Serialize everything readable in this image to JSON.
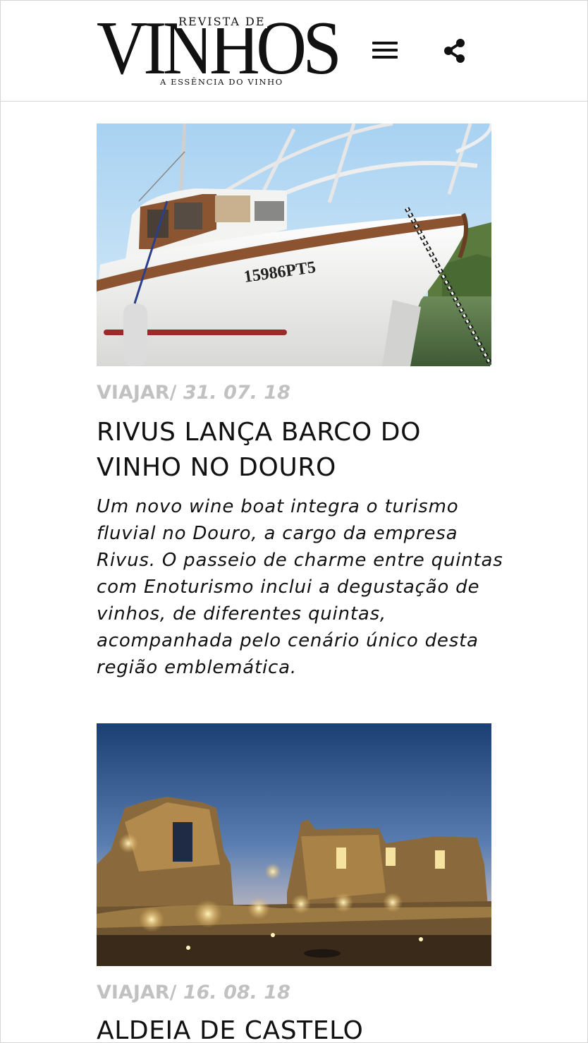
{
  "header": {
    "logo_top": "REVISTA DE",
    "logo_main": "VINHOS",
    "logo_tagline": "A ESSÊNCIA DO VINHO",
    "menu_icon": "hamburger-menu-icon",
    "share_icon": "share-icon"
  },
  "articles": [
    {
      "category": "VIAJAR/",
      "date": " 31. 07. 18",
      "title": "RIVUS LANÇA BARCO DO VINHO NO DOURO",
      "excerpt": "Um novo wine boat integra o turismo fluvial no Douro, a cargo da empresa Rivus. O passeio de charme entre quintas com Enoturismo inclui a degustação de vinhos, de diferentes quintas, acompanhada pelo cenário único desta região emblemática.",
      "image_text": "15986PT5"
    },
    {
      "category": "VIAJAR/",
      "date": " 16. 08. 18",
      "title": "ALDEIA DE CASTELO"
    }
  ],
  "colors": {
    "meta_gray": "#c1c1c1",
    "text": "#111111",
    "border": "#d6d6d6"
  }
}
